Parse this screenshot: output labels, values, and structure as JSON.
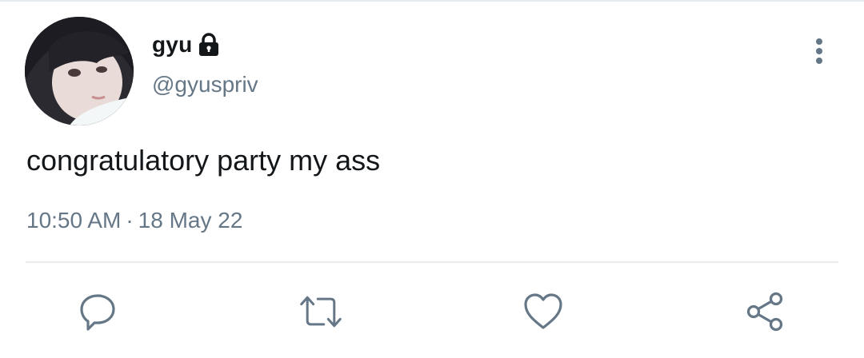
{
  "user": {
    "display_name": "gyu",
    "handle": "@gyuspriv",
    "protected_icon": "lock-icon",
    "avatar": "profile-photo"
  },
  "tweet": {
    "text": "congratulatory party my ass",
    "time": "10:50 AM",
    "separator": "·",
    "date": "18 May 22"
  },
  "actions": [
    {
      "name": "reply",
      "icon": "reply-icon"
    },
    {
      "name": "retweet",
      "icon": "retweet-icon"
    },
    {
      "name": "like",
      "icon": "heart-icon"
    },
    {
      "name": "share",
      "icon": "share-icon"
    }
  ],
  "menu_icon": "more-vertical-icon",
  "colors": {
    "text_primary": "#14171a",
    "text_secondary": "#657786",
    "icon": "#657786",
    "divider": "#e6ecf0",
    "background": "#ffffff"
  }
}
